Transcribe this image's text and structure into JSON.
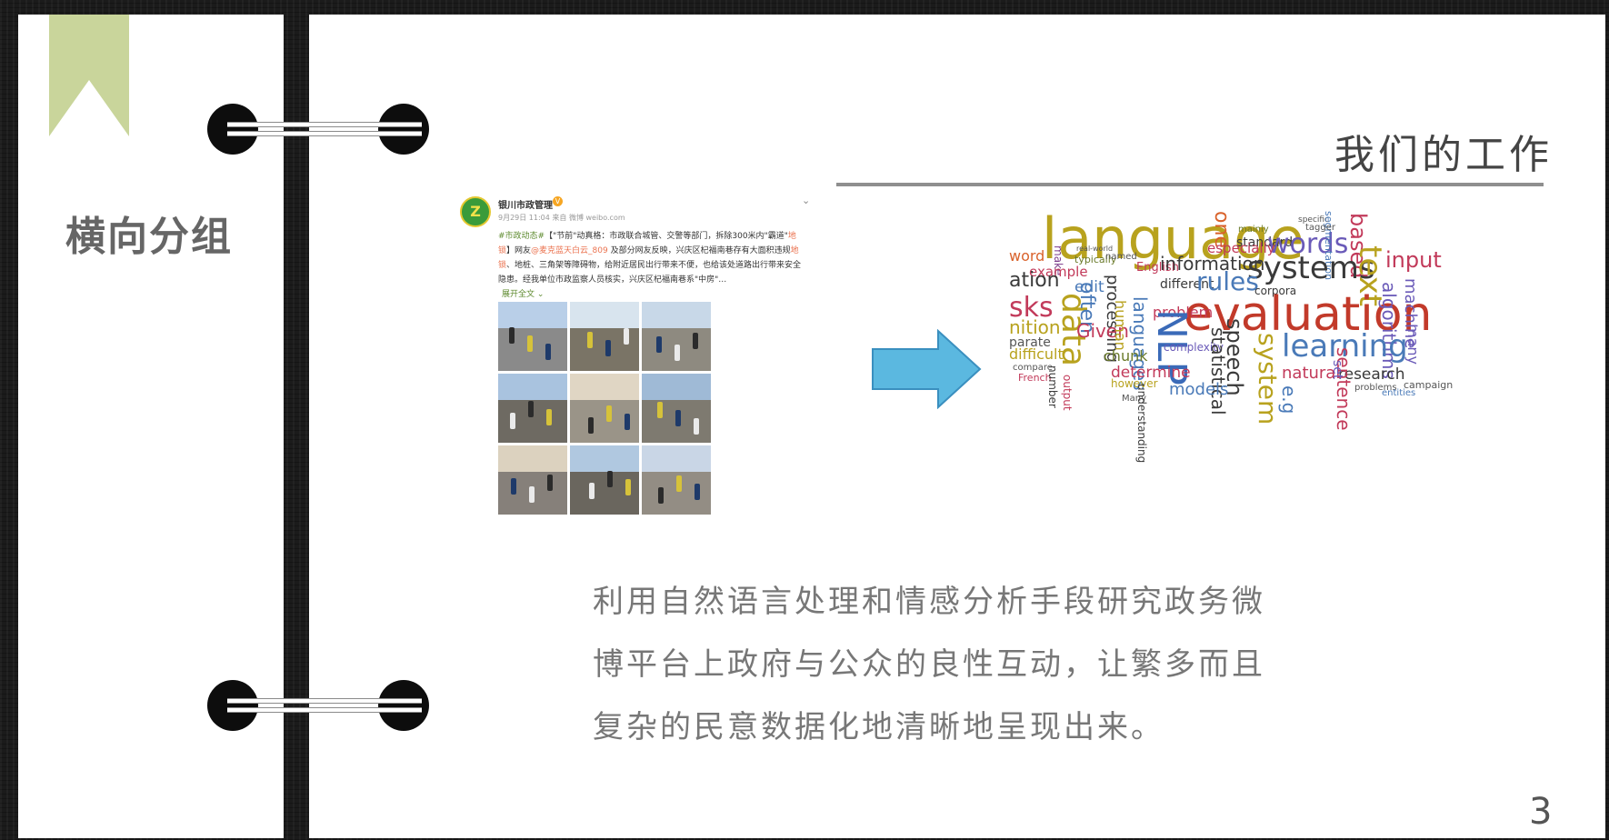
{
  "sidebar": {
    "section_title": "横向分组"
  },
  "slide": {
    "title": "我们的工作",
    "body_text": "利用自然语言处理和情感分析手段研究政务微博平台上政府与公众的良性互动，让繁多而且复杂的民意数据化地清晰地呈现出来。",
    "page_number": "3"
  },
  "weibo_post": {
    "account_name": "银川市政管理",
    "timestamp": "9月29日 11:04 来自 微博 weibo.com",
    "text_parts": [
      "#市政动态#",
      "【\"节前\"动真格：市政联合城管、交警等部门，拆除300米内\"霸道\"",
      "地锁",
      "】网友",
      "@麦克蓝天白云_809",
      " 及部分网友反映，兴庆区杞福南巷存有大面积违规",
      "地锁",
      "、地桩、三角架等障碍物，给附近居民出行带来不便，也给该处道路出行带来安全隐患。经我单位市政监察人员核实，兴庆区杞福南巷系\"中房\"…"
    ],
    "expand_label": "展开全文 ⌄",
    "photo_count": 9
  },
  "wordcloud": {
    "words": [
      {
        "t": "language",
        "c": "#b8a21e"
      },
      {
        "t": "one",
        "c": "#d9622b"
      },
      {
        "t": "mainly",
        "c": "#6a7a2a"
      },
      {
        "t": "standard",
        "c": "#3a3a3a"
      },
      {
        "t": "words",
        "c": "#6a5ab8"
      },
      {
        "t": "specific",
        "c": "#555"
      },
      {
        "t": "based",
        "c": "#c23a5a"
      },
      {
        "t": "segmentation",
        "c": "#4a7ab8"
      },
      {
        "t": "tagger",
        "c": "#555"
      },
      {
        "t": "word",
        "c": "#d9622b"
      },
      {
        "t": "make",
        "c": "#7a3a8a"
      },
      {
        "t": "real-world",
        "c": "#555"
      },
      {
        "t": "typically",
        "c": "#6a7a2a"
      },
      {
        "t": "named",
        "c": "#555"
      },
      {
        "t": "English",
        "c": "#c23a5a"
      },
      {
        "t": "information",
        "c": "#3a3a3a"
      },
      {
        "t": "especially",
        "c": "#c23a5a"
      },
      {
        "t": "systems",
        "c": "#3a3a3a"
      },
      {
        "t": "text",
        "c": "#b8a21e"
      },
      {
        "t": "input",
        "c": "#c23a5a"
      },
      {
        "t": "example",
        "c": "#c23a5a"
      },
      {
        "t": "ation",
        "c": "#3a3a3a"
      },
      {
        "t": "edit",
        "c": "#4a7ab8"
      },
      {
        "t": "different",
        "c": "#3a3a3a"
      },
      {
        "t": "rules",
        "c": "#4a7ab8"
      },
      {
        "t": "corpora",
        "c": "#3a3a3a"
      },
      {
        "t": "sks",
        "c": "#c23a5a"
      },
      {
        "t": "data",
        "c": "#b8a21e"
      },
      {
        "t": "often",
        "c": "#4a7ab8"
      },
      {
        "t": "processing",
        "c": "#3a3a3a"
      },
      {
        "t": "evaluation",
        "c": "#c23a2a"
      },
      {
        "t": "algorithms",
        "c": "#6a5ab8"
      },
      {
        "t": "machine",
        "c": "#6a5ab8"
      },
      {
        "t": "nition",
        "c": "#b8a21e"
      },
      {
        "t": "Given",
        "c": "#c23a5a"
      },
      {
        "t": "human",
        "c": "#b8a21e"
      },
      {
        "t": "languages",
        "c": "#4a7ab8"
      },
      {
        "t": "problem",
        "c": "#c23a5a"
      },
      {
        "t": "NLP",
        "c": "#3a6ab8"
      },
      {
        "t": "parate",
        "c": "#555"
      },
      {
        "t": "complexity",
        "c": "#6a5ab8"
      },
      {
        "t": "learning",
        "c": "#4a7ab8"
      },
      {
        "t": "difficult",
        "c": "#b8a21e"
      },
      {
        "t": "chunk",
        "c": "#6a7a2a"
      },
      {
        "t": "statistical",
        "c": "#3a3a3a"
      },
      {
        "t": "speech",
        "c": "#3a3a3a"
      },
      {
        "t": "system",
        "c": "#b8a21e"
      },
      {
        "t": "many",
        "c": "#6a5ab8"
      },
      {
        "t": "compare",
        "c": "#555"
      },
      {
        "t": "French",
        "c": "#c23a5a"
      },
      {
        "t": "determine",
        "c": "#c23a5a"
      },
      {
        "t": "natural",
        "c": "#c23a5a"
      },
      {
        "t": "research",
        "c": "#3a3a3a"
      },
      {
        "t": "however",
        "c": "#b8a21e"
      },
      {
        "t": "models",
        "c": "#4a7ab8"
      },
      {
        "t": "sentence",
        "c": "#c23a5a"
      },
      {
        "t": "set",
        "c": "#6a5ab8"
      },
      {
        "t": "e.g",
        "c": "#4a7ab8"
      },
      {
        "t": "problems",
        "c": "#555"
      },
      {
        "t": "campaign",
        "c": "#555"
      },
      {
        "t": "entities",
        "c": "#4a7ab8"
      },
      {
        "t": "Many",
        "c": "#555"
      },
      {
        "t": "understanding",
        "c": "#3a3a3a"
      },
      {
        "t": "output",
        "c": "#c23a5a"
      },
      {
        "t": "number",
        "c": "#3a3a3a"
      }
    ]
  },
  "colors": {
    "bookmark": "#c9d59b",
    "arrow_fill": "#5bb8e0",
    "arrow_stroke": "#3a8fbf"
  },
  "icons": {
    "ring_binder": "binder-ring-icon",
    "arrow": "arrow-right-icon"
  }
}
